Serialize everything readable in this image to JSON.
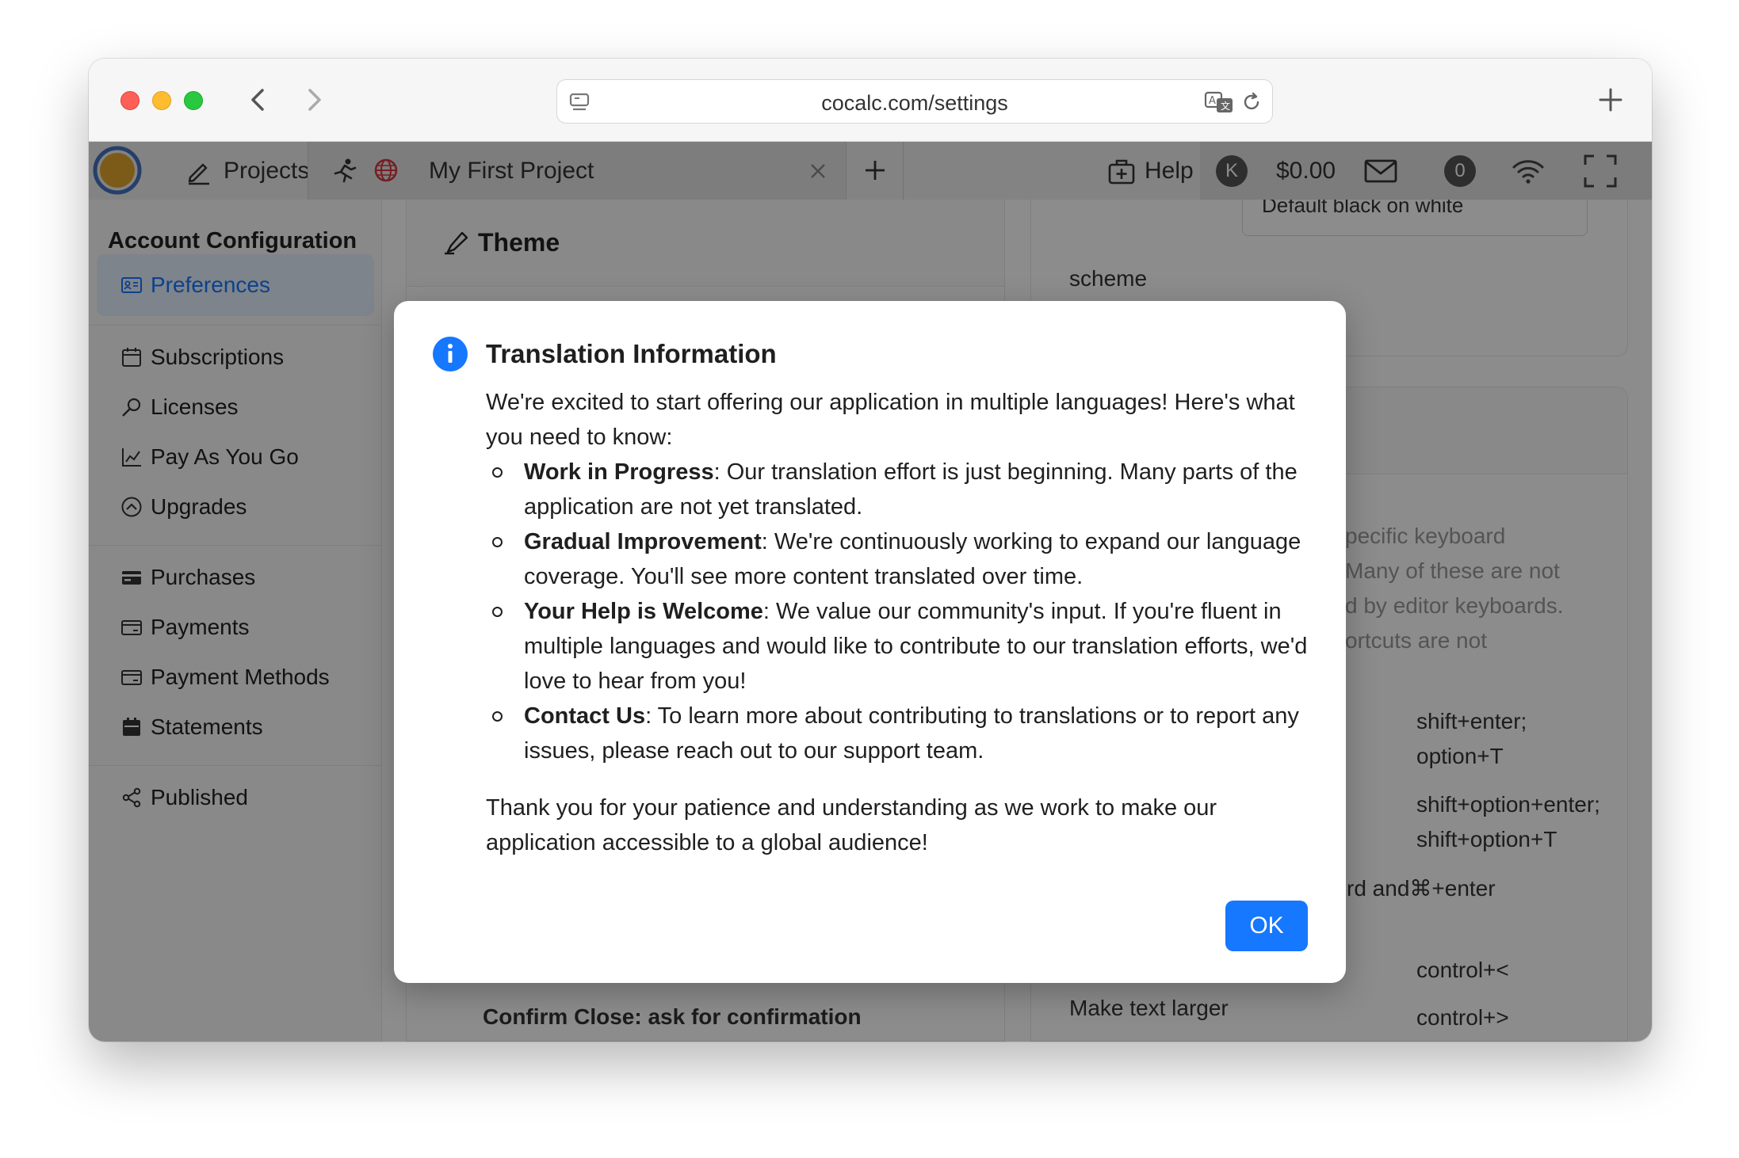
{
  "browser": {
    "url": "cocalc.com/settings"
  },
  "appbar": {
    "projects_label": "Projects",
    "project_tab_title": "My First Project",
    "help_label": "Help",
    "avatar_letter": "K",
    "balance": "$0.00",
    "notification_count": "0"
  },
  "sidebar": {
    "title": "Account Configuration",
    "items": [
      {
        "label": "Preferences",
        "icon": "id-card-icon",
        "active": true
      },
      {
        "label": "Subscriptions",
        "icon": "calendar-icon"
      },
      {
        "label": "Licenses",
        "icon": "key-icon"
      },
      {
        "label": "Pay As You Go",
        "icon": "line-chart-icon"
      },
      {
        "label": "Upgrades",
        "icon": "arrow-circle-up-icon"
      },
      {
        "label": "Purchases",
        "icon": "credit-card-icon"
      },
      {
        "label": "Payments",
        "icon": "credit-card-outline-icon"
      },
      {
        "label": "Payment Methods",
        "icon": "credit-card-outline-icon"
      },
      {
        "label": "Statements",
        "icon": "calendar-filled-icon"
      },
      {
        "label": "Published",
        "icon": "share-icon"
      }
    ]
  },
  "theme_card": {
    "title": "Theme",
    "cut_text": "Confirm Close: ask for confirmation"
  },
  "editor_card": {
    "scheme_label": "scheme",
    "scheme_value": "Default black on white"
  },
  "keyboard_card": {
    "description_lines": [
      "pecific keyboard",
      "Many of these are not",
      "d by editor keyboards.",
      "ortcuts are not"
    ],
    "shortcuts": [
      [
        "shift+enter;",
        "option+T"
      ],
      [
        "shift+option+enter;",
        "shift+option+T"
      ],
      [
        "rd and⌘+enter"
      ],
      [
        "control+<"
      ],
      [
        "control+>"
      ]
    ],
    "partial_label": "Make text larger"
  },
  "modal": {
    "title": "Translation Information",
    "intro": "We're excited to start offering our application in multiple languages! Here's what you need to know:",
    "items": [
      {
        "head": "Work in Progress",
        "text": ": Our translation effort is just beginning. Many parts of the application are not yet translated."
      },
      {
        "head": "Gradual Improvement",
        "text": ": We're continuously working to expand our language coverage. You'll see more content translated over time."
      },
      {
        "head": "Your Help is Welcome",
        "text": ": We value our community's input. If you're fluent in multiple languages and would like to contribute to our translation efforts, we'd love to hear from you!"
      },
      {
        "head": "Contact Us",
        "text": ": To learn more about contributing to translations or to report any issues, please reach out to our support team."
      }
    ],
    "closing": "Thank you for your patience and understanding as we work to make our application accessible to a global audience!",
    "ok_label": "OK"
  },
  "colors": {
    "accent": "#1677ff",
    "overlay": "rgba(0,0,0,0.45)"
  }
}
